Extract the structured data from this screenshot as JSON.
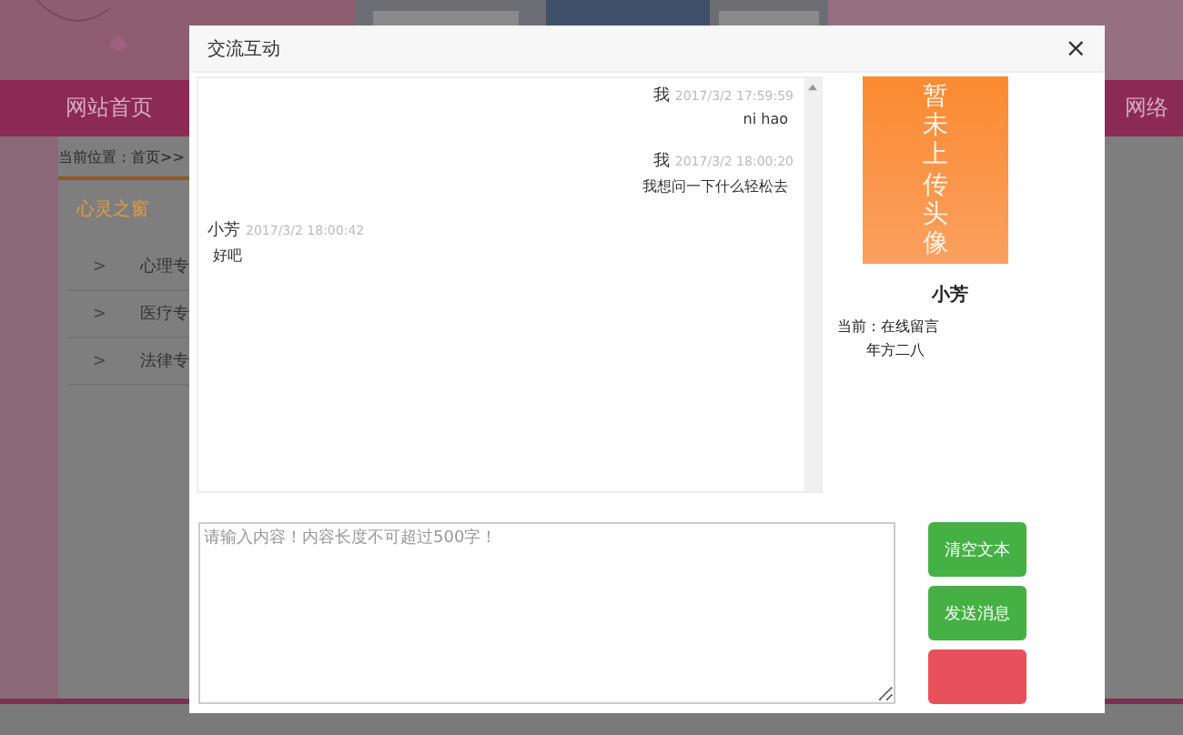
{
  "site": {
    "nav": [
      {
        "label": "网站首页"
      },
      {
        "label": "网络"
      }
    ],
    "breadcrumb": "当前位置：首页>>",
    "sidebar": {
      "title": "心灵之窗",
      "items": [
        {
          "chevron": ">",
          "label": "心理专"
        },
        {
          "chevron": ">",
          "label": "医疗专"
        },
        {
          "chevron": ">",
          "label": "法律专"
        }
      ]
    }
  },
  "dialog": {
    "title": "交流互动",
    "close": "×",
    "messages": [
      {
        "kind": "me",
        "sender": "我",
        "time": "2017/3/2 17:59:59",
        "text": "ni hao"
      },
      {
        "kind": "me",
        "sender": "我",
        "time": "2017/3/2 18:00:20",
        "text": "我想问一下什么轻松去"
      },
      {
        "kind": "other",
        "sender": "小芳",
        "time": "2017/3/2 18:00:42",
        "text": "好吧"
      }
    ],
    "profile": {
      "avatar_text": "暂未上传头像",
      "name": "小芳",
      "status": "当前：在线留言",
      "note": "年方二八"
    },
    "input": {
      "placeholder": "请输入内容！内容长度不可超过500字！"
    },
    "buttons": [
      {
        "kind": "green",
        "label": "清空文本"
      },
      {
        "kind": "green",
        "label": "发送消息"
      },
      {
        "kind": "red"
      }
    ]
  }
}
